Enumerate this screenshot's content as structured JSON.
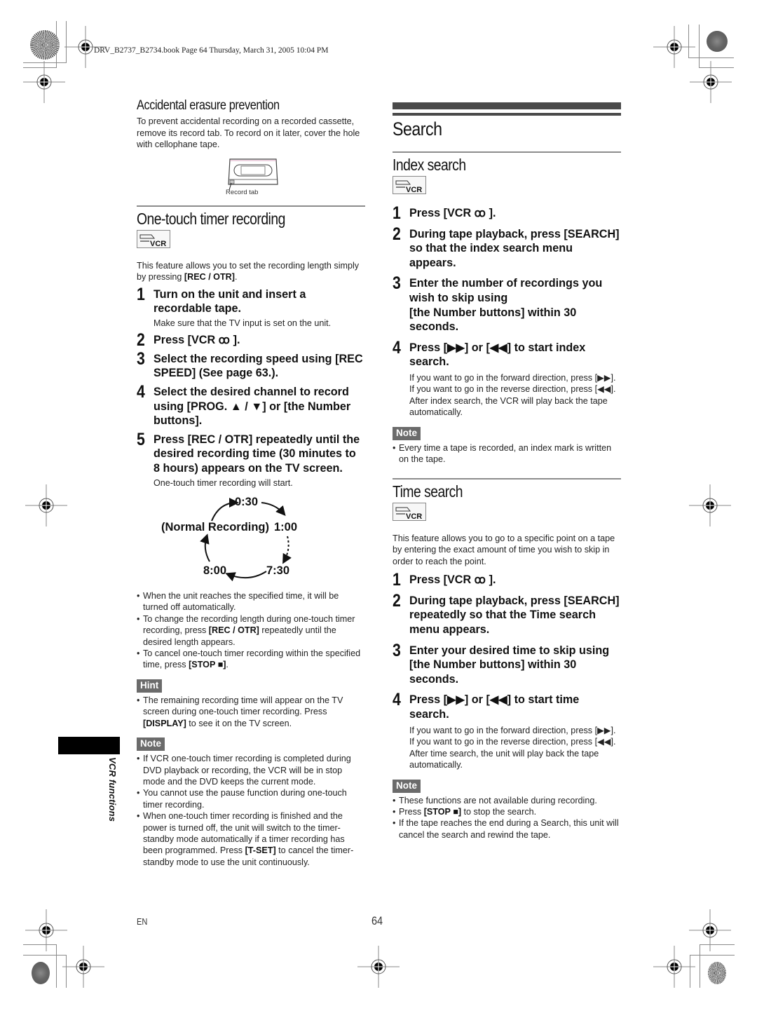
{
  "print_header": "DRV_B2737_B2734.book  Page 64  Thursday, March 31, 2005  10:04 PM",
  "left": {
    "erasure": {
      "heading": "Accidental erasure prevention",
      "body": "To prevent accidental recording on a recorded cassette, remove its record tab. To record on it later, cover the hole with cellophane tape.",
      "figure_caption": "Record tab"
    },
    "one_touch": {
      "heading": "One-touch timer recording",
      "vcr_badge": "VCR",
      "intro_prefix": "This feature allows you to set the recording length simply by pressing ",
      "intro_key": "[REC / OTR]",
      "intro_suffix": ".",
      "steps": [
        {
          "num": "1",
          "text": "Turn on the unit and insert a recordable tape.",
          "sub": "Make sure that the TV input is set on the unit."
        },
        {
          "num": "2",
          "text_prefix": "Press [VCR ",
          "text_icon": "ꝏ",
          "text_suffix": " ]."
        },
        {
          "num": "3",
          "text": "Select the recording speed using [REC SPEED] (See page 63.)."
        },
        {
          "num": "4",
          "text": "Select the desired channel to record using [PROG. ▲ / ▼] or [the Number buttons]."
        },
        {
          "num": "5",
          "text": "Press [REC / OTR] repeatedly until the desired recording time (30 minutes to 8 hours) appears on the TV screen.",
          "sub": "One-touch timer recording will start."
        }
      ],
      "cycle": {
        "top": "0:30",
        "left": "(Normal Recording)",
        "right": "1:00",
        "bottom_left": "8:00",
        "bottom_right": "7:30"
      },
      "bullets": [
        {
          "text": "When the unit reaches the specified time, it will be turned off automatically."
        },
        {
          "pre": "To change the recording length during one-touch timer recording, press ",
          "key": "[REC / OTR]",
          "post": " repeatedly until the desired length appears."
        },
        {
          "pre": "To cancel one-touch timer recording within the specified time, press ",
          "key": "[STOP ■]",
          "post": "."
        }
      ],
      "hint_label": "Hint",
      "hint_bullets": [
        {
          "pre": "The remaining recording time will appear on the TV screen during one-touch timer recording. Press ",
          "key": "[DISPLAY]",
          "post": " to see it on the TV screen."
        }
      ],
      "note_label": "Note",
      "note_bullets": [
        {
          "text": "If VCR one-touch timer recording is completed during DVD playback or recording, the VCR will be in stop mode and the DVD keeps the current mode."
        },
        {
          "text": "You cannot use the pause function during one-touch timer recording."
        },
        {
          "pre": "When one-touch timer recording is finished and the power is turned off, the unit will switch to the timer-standby mode automatically if a timer recording has been programmed. Press ",
          "key": "[T-SET]",
          "post": " to cancel the timer-standby mode to use the unit continuously."
        }
      ]
    }
  },
  "right": {
    "title": "Search",
    "index": {
      "heading": "Index search",
      "vcr_badge": "VCR",
      "steps": [
        {
          "num": "1",
          "text_prefix": "Press [VCR ",
          "text_icon": "ꝏ",
          "text_suffix": " ]."
        },
        {
          "num": "2",
          "text": "During tape playback, press [SEARCH] so that the index search menu appears."
        },
        {
          "num": "3",
          "text": "Enter the number of recordings you wish to skip using",
          "text2": "[the Number buttons] within 30 seconds."
        },
        {
          "num": "4",
          "text": "Press [▶▶] or [◀◀] to start index search.",
          "sub_lines": [
            "If you want to go in the forward direction, press [▶▶].",
            "If you want to go in the reverse direction, press [◀◀].",
            "After index search, the VCR will play back the tape automatically."
          ]
        }
      ],
      "note_label": "Note",
      "note_bullets": [
        {
          "text": "Every time a tape is recorded, an index mark is written on the tape."
        }
      ]
    },
    "time": {
      "heading": "Time search",
      "vcr_badge": "VCR",
      "intro": "This feature allows you to go to a specific point on a tape by entering the exact amount of time you wish to skip in order to reach the point.",
      "steps": [
        {
          "num": "1",
          "text_prefix": "Press [VCR ",
          "text_icon": "ꝏ",
          "text_suffix": " ]."
        },
        {
          "num": "2",
          "text": "During tape playback, press [SEARCH] repeatedly so that the Time search menu appears."
        },
        {
          "num": "3",
          "text": "Enter your desired time to skip using [the Number buttons] within 30 seconds."
        },
        {
          "num": "4",
          "text": "Press [▶▶] or [◀◀] to start time search.",
          "sub_lines": [
            "If you want to go in the forward direction, press [▶▶].",
            "If you want to go in the reverse direction, press [◀◀].",
            "After time search, the unit will play back the tape automatically."
          ]
        }
      ],
      "note_label": "Note",
      "note_bullets": [
        {
          "text": "These functions are not available during recording."
        },
        {
          "pre": "Press ",
          "key": "[STOP ■]",
          "post": " to stop the search."
        },
        {
          "text": "If the tape reaches the end during a Search, this unit will cancel the search and rewind the tape."
        }
      ]
    }
  },
  "side_tab_label": "VCR functions",
  "footer": {
    "lang": "EN",
    "page_number": "64"
  }
}
